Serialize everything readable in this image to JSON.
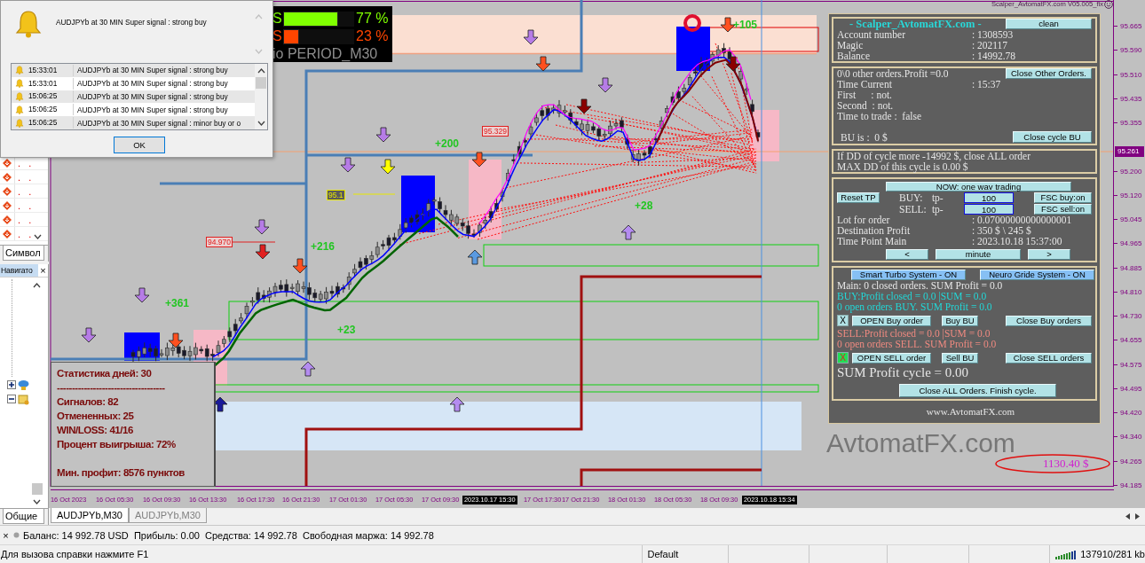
{
  "alert_dialog": {
    "message": "AUDJPYb at 30 MIN Super signal : strong buy",
    "rows": [
      {
        "time": "15:33:01",
        "text": "AUDJPYb at 30 MIN Super signal : strong buy"
      },
      {
        "time": "15:33:01",
        "text": "AUDJPYb at 30 MIN Super signal : strong buy"
      },
      {
        "time": "15:06:25",
        "text": "AUDJPYb at 30 MIN Super signal : strong buy"
      },
      {
        "time": "15:06:25",
        "text": "AUDJPYb at 30 MIN Super signal : strong buy"
      },
      {
        "time": "15:06:25",
        "text": "AUDJPYb at 30 MIN Super signal : minor buy or o"
      }
    ],
    "ok_button": "OK"
  },
  "market_watch": {
    "rows": [
      {
        "bid": ".",
        "ask": "."
      },
      {
        "bid": ".",
        "ask": "."
      },
      {
        "bid": ".",
        "ask": "."
      },
      {
        "bid": ".",
        "ask": "."
      },
      {
        "bid": ".",
        "ask": "."
      },
      {
        "bid": ".",
        "ask": "."
      }
    ],
    "tab": "Символ"
  },
  "navigator": {
    "title": "Навигато",
    "close": "×",
    "tree": [
      {
        "expanded": false
      },
      {
        "expanded": true
      }
    ],
    "tab": "Общие"
  },
  "chart": {
    "title": "Scalper_AvtomatFX.com V05.005_fix",
    "signal_meter": {
      "rows": [
        {
          "label": "S",
          "level": 0.77,
          "percent": "77 %",
          "color": "#80ff00"
        },
        {
          "label": "S",
          "level": 0.23,
          "percent": "23 %",
          "color": "#ff4500"
        }
      ],
      "period": "io PERIOD_M30"
    },
    "labels": [
      "+361",
      "+216",
      "+23",
      "+200",
      "+28",
      "+105"
    ],
    "price_tags": [
      {
        "text": "94.970",
        "color": "#e02020"
      },
      {
        "text": "95.329",
        "color": "#e02020"
      },
      {
        "text": "95.1",
        "color": "#e8e800"
      }
    ],
    "stats": {
      "title": "Статистика дней: 30",
      "separator": "------------------------------------",
      "lines": [
        "Сигналов: 82",
        "Отмененных: 25",
        "WIN/LOSS: 41/16",
        "Процент выигрыша: 72%"
      ],
      "footer": "Мин. профит: 8576 пунктов"
    },
    "profit_note": "1130.40 $",
    "brand": "AvtomatFX.com",
    "price_axis": [
      "95.665",
      "95.590",
      "95.510",
      "95.435",
      "95.355",
      "95.200",
      "95.120",
      "95.045",
      "94.965",
      "94.885",
      "94.810",
      "94.730",
      "94.655",
      "94.575",
      "94.495",
      "94.420",
      "94.340",
      "94.265",
      "94.185"
    ],
    "current_price": "95.261",
    "time_axis": [
      {
        "label": "16 Oct 2023",
        "kind": "tick"
      },
      {
        "label": "16 Oct 05:30",
        "kind": "tick"
      },
      {
        "label": "16 Oct 09:30",
        "kind": "tick"
      },
      {
        "label": "16 Oct 13:30",
        "kind": "tick"
      },
      {
        "label": "16 Oct 17:30",
        "kind": "tick"
      },
      {
        "label": "16 Oct 21:30",
        "kind": "tick"
      },
      {
        "label": "17 Oct 01:30",
        "kind": "tick"
      },
      {
        "label": "17 Oct 05:30",
        "kind": "tick"
      },
      {
        "label": "17 Oct 09:30",
        "kind": "tick"
      },
      {
        "label": "2023.10.17 15:30",
        "kind": "marker"
      },
      {
        "label": "17 Oct 17:30",
        "kind": "tick"
      },
      {
        "label": "17 Oct 21:30",
        "kind": "tick"
      },
      {
        "label": "18 Oct 01:30",
        "kind": "tick"
      },
      {
        "label": "18 Oct 05:30",
        "kind": "tick"
      },
      {
        "label": "18 Oct 09:30",
        "kind": "tick"
      },
      {
        "label": "2023.10.18 15:34",
        "kind": "marker"
      }
    ]
  },
  "ea_panel": {
    "title": "- Scalper_AvtomatFX.com -",
    "clean_button": "clean",
    "account": [
      {
        "label": "Account number",
        "value": ": 1308593"
      },
      {
        "label": "Magic",
        "value": ": 202117"
      },
      {
        "label": "Balance",
        "value": ": 14992.78"
      }
    ],
    "orders": {
      "summary": "0\\0 other orders.Profit =0.0",
      "close_other_button": "Close Other Orders.",
      "rows": [
        {
          "label": "Time Current",
          "value": ": 15:37"
        },
        {
          "label": "First      : not."
        },
        {
          "label": "Second  : not."
        },
        {
          "label": "Time to trade :  false"
        }
      ],
      "bu": "BU is :  0 $",
      "close_cycle_button": "Close cycle BU"
    },
    "drawdown": [
      "If DD of cycle more -14992 $, close ALL order",
      "MAX DD of this cycle is 0.00 $"
    ],
    "trading": {
      "mode_button": "NOW: one wav trading",
      "reset_button": "Reset TP",
      "sides": [
        {
          "side": "BUY:",
          "tp": "tp-",
          "value": "100",
          "fsc_button": "FSC buy:on"
        },
        {
          "side": "SELL:",
          "tp": "tp-",
          "value": "100",
          "fsc_button": "FSC sell:on"
        }
      ],
      "rows": [
        {
          "label": "Lot for order",
          "value": ": 0.07000000000000001"
        },
        {
          "label": "Destination Profit",
          "value": ": 350 $ \\ 245 $"
        },
        {
          "label": "Time Point Main",
          "value": ": 2023.10.18 15:37:00"
        }
      ],
      "nav_buttons": [
        "<",
        "minute",
        ">"
      ]
    },
    "systems": {
      "buttons": [
        {
          "label": "Smart Turbo System - ON",
          "on": true
        },
        {
          "label": "Neuro Gride System - ON",
          "on": true
        }
      ],
      "main": "Main: 0 closed orders. SUM Profit = 0.0",
      "groups": [
        {
          "kind": "buy",
          "lines": [
            "BUY:Profit closed = 0.0 |SUM = 0.0",
            "0 open orders BUY. SUM Profit = 0.0"
          ],
          "toggle": {
            "text": "X",
            "active": false
          },
          "open_button": "OPEN Buy order",
          "bu_button": "Buy BU",
          "close_button": "Close Buy orders"
        },
        {
          "kind": "sell",
          "lines": [
            "SELL:Profit closed = 0.0 |SUM = 0.0",
            "0 open orders SELL. SUM Profit = 0.0"
          ],
          "toggle": {
            "text": "X",
            "active": true
          },
          "open_button": "OPEN SELL order",
          "bu_button": "Sell BU",
          "close_button": "Close SELL orders"
        }
      ],
      "sum": "SUM Profit cycle = 0.00",
      "close_all_button": "Close ALL Orders. Finish cycle."
    },
    "footer": "www.AvtomatFX.com"
  },
  "chart_tabs": [
    {
      "label": "AUDJPYb,M30",
      "selected": true
    },
    {
      "label": "AUDJPYb,M30",
      "selected": false
    }
  ],
  "terminal": {
    "close": "×",
    "account_line": "Баланс: 14 992.78 USD  Прибыль: 0.00  Средства: 14 992.78  Свободная маржа: 14 992.78"
  },
  "status_bar": {
    "help": "Для вызова справки нажмите F1",
    "profile": "Default",
    "traffic": "137910/281 kb"
  }
}
